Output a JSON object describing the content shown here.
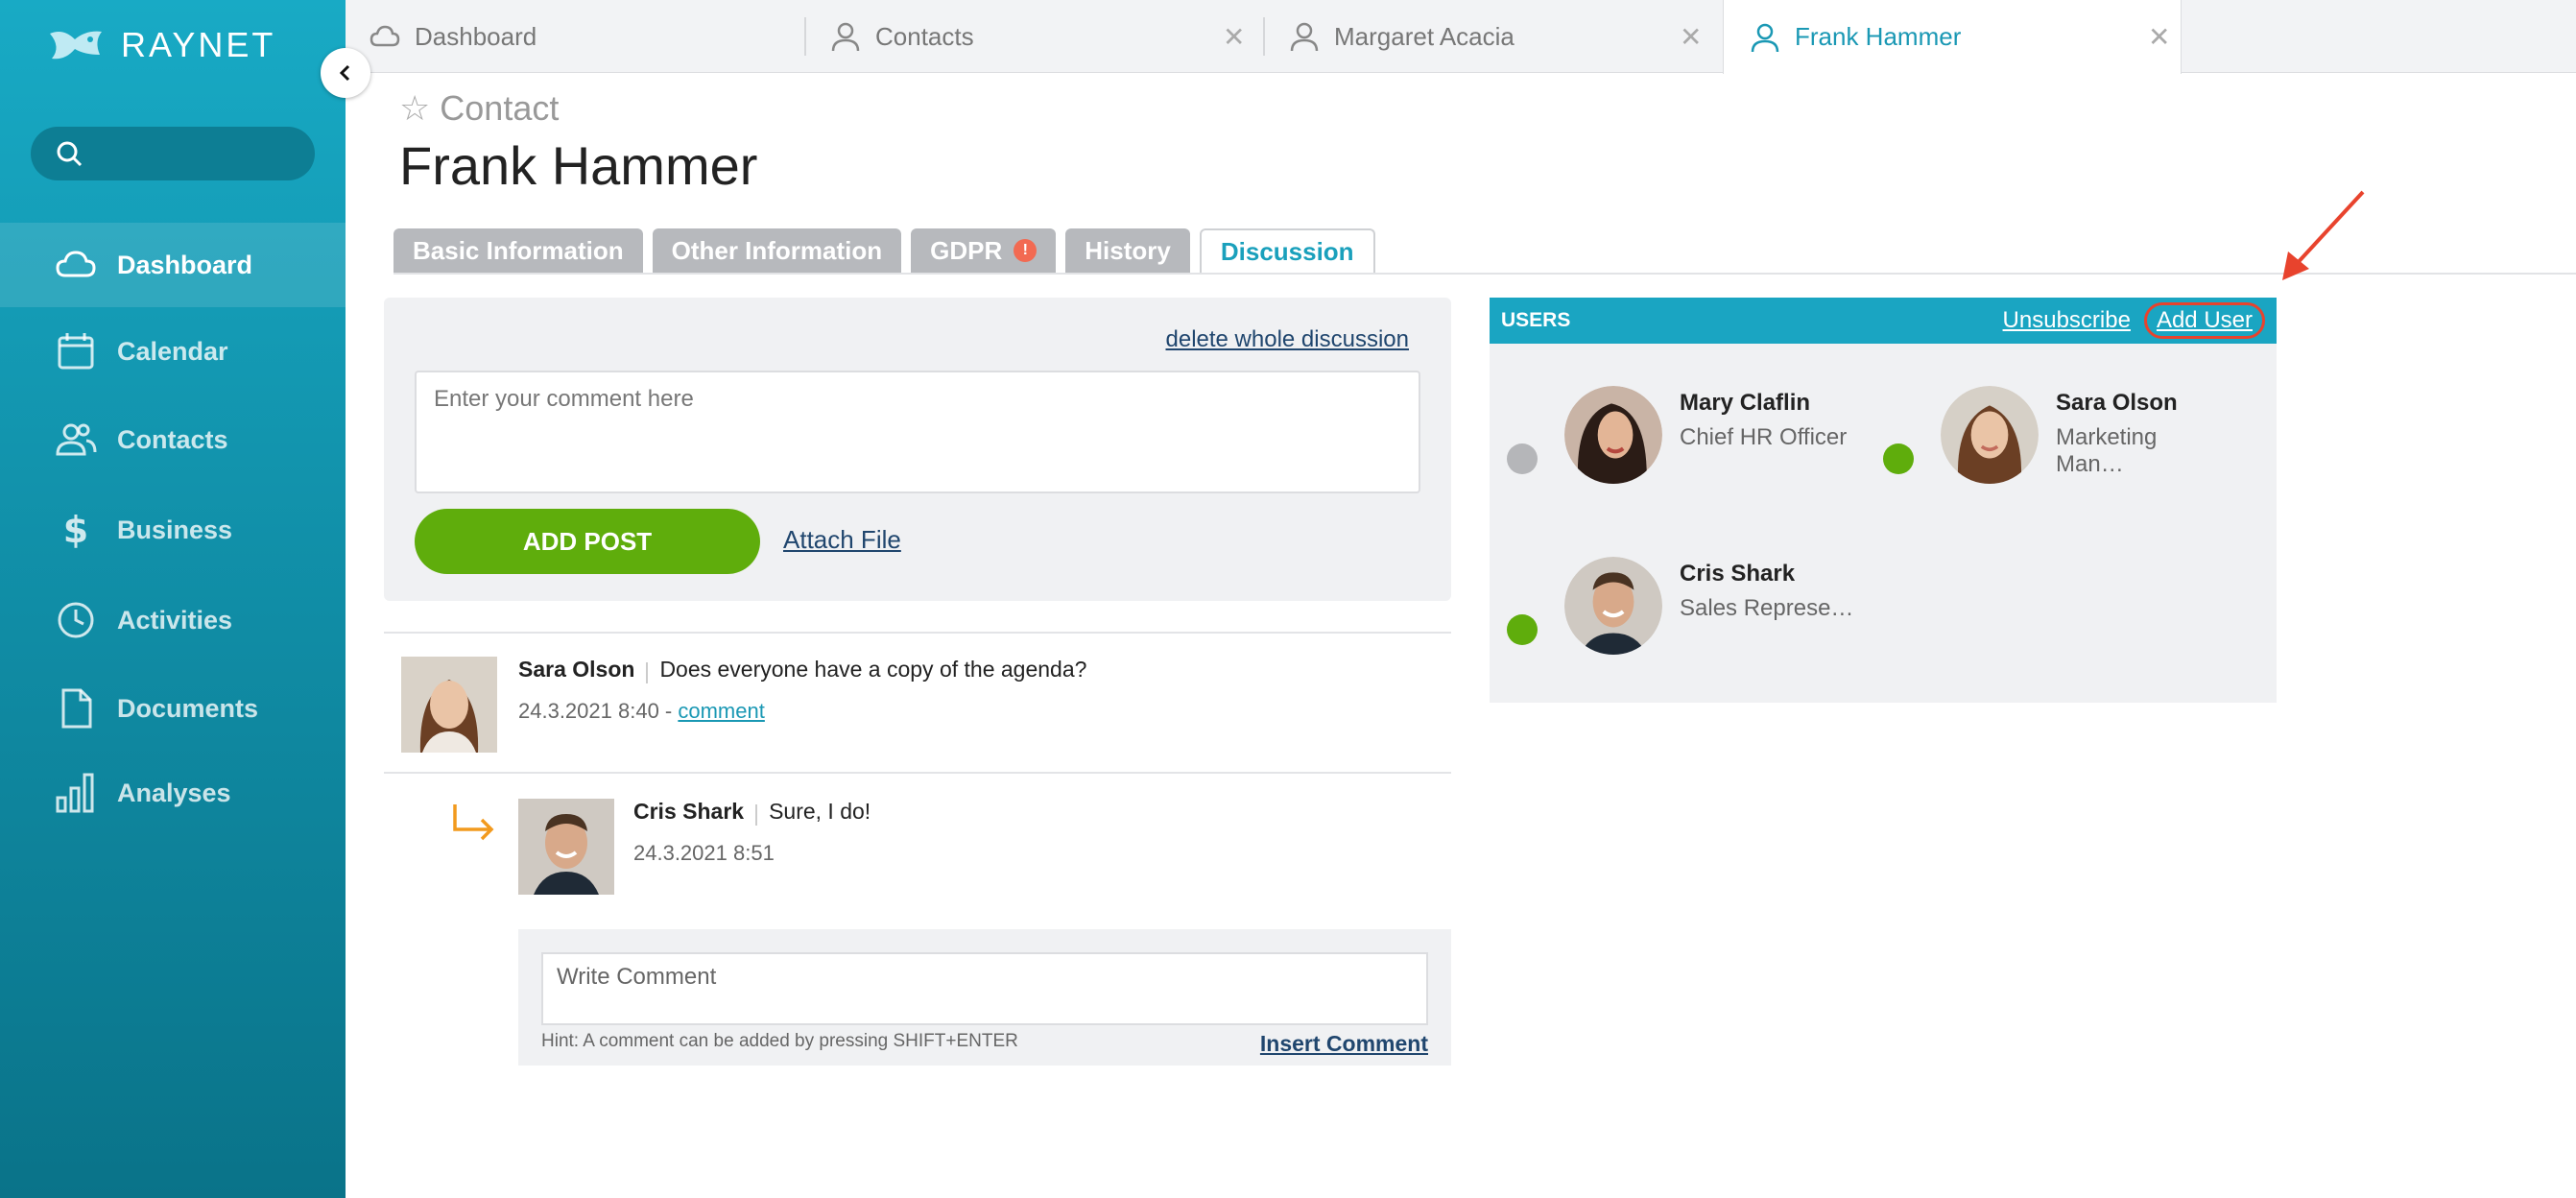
{
  "app": {
    "logo_text": "RAYNET",
    "brand_color": "#18aac5"
  },
  "search": {
    "placeholder": ""
  },
  "sidebar": {
    "items": [
      {
        "label": "Dashboard",
        "icon": "cloud-icon",
        "active": true
      },
      {
        "label": "Calendar",
        "icon": "calendar-icon"
      },
      {
        "label": "Contacts",
        "icon": "contacts-icon"
      },
      {
        "label": "Business",
        "icon": "dollar-icon"
      },
      {
        "label": "Activities",
        "icon": "clock-icon"
      },
      {
        "label": "Documents",
        "icon": "document-icon"
      },
      {
        "label": "Analyses",
        "icon": "bar-chart-icon"
      }
    ]
  },
  "tabs": [
    {
      "label": "Dashboard",
      "icon": "cloud-icon",
      "closable": false
    },
    {
      "label": "Contacts",
      "icon": "person-icon",
      "closable": true
    },
    {
      "label": "Margaret Acacia",
      "icon": "person-icon",
      "closable": true
    },
    {
      "label": "Frank Hammer",
      "icon": "person-icon",
      "closable": true,
      "active": true
    }
  ],
  "tab_more": "···",
  "header": {
    "breadcrumb": "Contact",
    "title": "Frank Hammer"
  },
  "content_tabs": [
    {
      "label": "Basic Information"
    },
    {
      "label": "Other Information"
    },
    {
      "label": "GDPR",
      "badge": "!"
    },
    {
      "label": "History"
    },
    {
      "label": "Discussion",
      "active": true
    }
  ],
  "discussion": {
    "delete_link": "delete whole discussion",
    "comment_placeholder": "Enter your comment here",
    "add_post": "ADD POST",
    "attach_file": "Attach File",
    "messages": [
      {
        "author": "Sara Olson",
        "text": "Does everyone have a copy of the agenda?",
        "time": "24.3.2021 8:40 -",
        "link": "comment"
      },
      {
        "author": "Cris Shark",
        "text": "Sure, I do!",
        "time": "24.3.2021 8:51"
      }
    ],
    "write_placeholder": "Write Comment",
    "hint": "Hint: A comment can be added by pressing SHIFT+ENTER",
    "insert": "Insert Comment"
  },
  "users": {
    "title": "USERS",
    "unsubscribe": "Unsubscribe",
    "add_user": "Add User",
    "list": [
      {
        "name": "Mary Claflin",
        "role": "Chief HR Officer",
        "status_color": "#b5b6b9"
      },
      {
        "name": "Sara Olson",
        "role": "Marketing Man…",
        "status_color": "#5fad0c"
      },
      {
        "name": "Cris Shark",
        "role": "Sales Represe…",
        "status_color": "#5fad0c"
      }
    ]
  },
  "annotation_color": "#e8432d"
}
